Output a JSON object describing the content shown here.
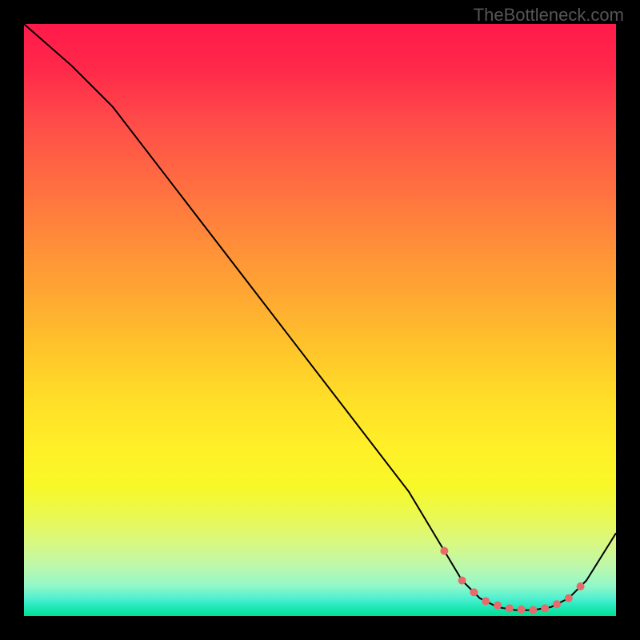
{
  "watermark": "TheBottleneck.com",
  "chart_data": {
    "type": "line",
    "title": "",
    "xlabel": "",
    "ylabel": "",
    "xlim": [
      0,
      100
    ],
    "ylim": [
      0,
      100
    ],
    "grid": false,
    "series": [
      {
        "name": "curve",
        "color": "#000000",
        "x": [
          0,
          8,
          15,
          25,
          35,
          45,
          55,
          65,
          71,
          74,
          77,
          80,
          83,
          86,
          89,
          92,
          95,
          100
        ],
        "y": [
          100,
          93,
          86,
          73,
          60,
          47,
          34,
          21,
          11,
          6,
          3,
          1.5,
          1,
          1,
          1.5,
          3,
          6,
          14
        ]
      }
    ],
    "markers": {
      "name": "highlight-points",
      "color": "#e86a6a",
      "x": [
        71,
        74,
        76,
        78,
        80,
        82,
        84,
        86,
        88,
        90,
        92,
        94
      ],
      "y": [
        11,
        6,
        4,
        2.5,
        1.8,
        1.3,
        1.1,
        1,
        1.3,
        2,
        3,
        5
      ]
    },
    "gradient_stops": [
      {
        "pos": 0,
        "color": "#ff1a4a"
      },
      {
        "pos": 50,
        "color": "#ffc82a"
      },
      {
        "pos": 80,
        "color": "#f8f828"
      },
      {
        "pos": 100,
        "color": "#00e090"
      }
    ]
  }
}
